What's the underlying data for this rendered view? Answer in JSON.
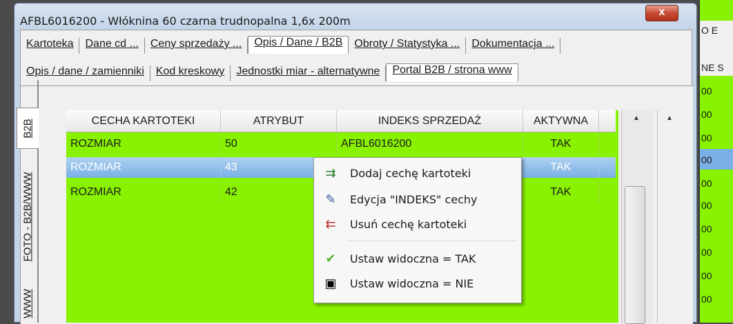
{
  "window": {
    "title": "AFBL6016200 - Włóknina 60 czarna trudnopalna 1,6x 200m",
    "close": "x"
  },
  "tabs_top": [
    "Kartoteka",
    "Dane cd ...",
    "Ceny sprzedaży ...",
    "Opis / Dane / B2B",
    "Obroty / Statystyka ...",
    "Dokumentacja ..."
  ],
  "tabs_sub": [
    "Opis / dane / zamienniki",
    "Kod kreskowy",
    "Jednostki miar - alternatywne",
    "Portal B2B / strona www"
  ],
  "vtabs": [
    "B2B",
    "FOTO - B2B/WWW",
    "WWW"
  ],
  "table": {
    "headers": [
      "CECHA KARTOTEKI",
      "ATRYBUT",
      "INDEKS SPRZEDAŻ",
      "AKTYWNA"
    ],
    "rows": [
      [
        "ROZMIAR",
        "50",
        "AFBL6016200",
        "TAK"
      ],
      [
        "ROZMIAR",
        "43",
        "",
        "TAK"
      ],
      [
        "ROZMIAR",
        "42",
        "",
        "TAK"
      ]
    ]
  },
  "context_menu": [
    {
      "icon": "add-feature-icon",
      "label": "Dodaj cechę kartoteki"
    },
    {
      "icon": "edit-index-icon",
      "label": "Edycja \"INDEKS\" cechy"
    },
    {
      "icon": "remove-feature-icon",
      "label": "Usuń cechę kartoteki"
    },
    {
      "icon": "checkmark-icon",
      "label": "Ustaw widoczna = TAK"
    },
    {
      "icon": "square-icon",
      "label": "Ustaw widoczna = NIE"
    }
  ],
  "right_panel": {
    "header": "O E",
    "col": "NE S",
    "cell": "00"
  }
}
